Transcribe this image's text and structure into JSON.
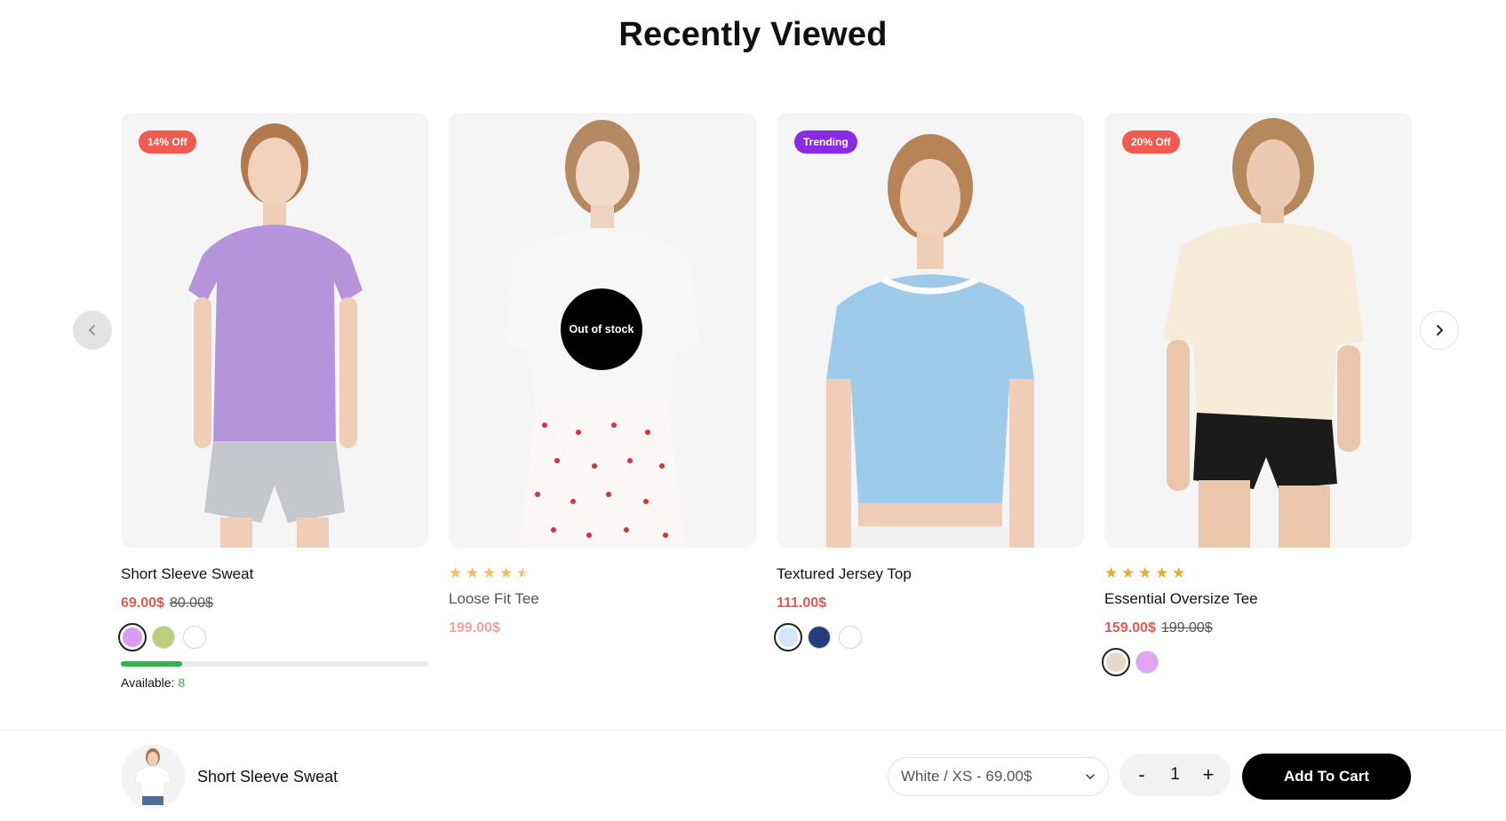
{
  "section": {
    "title": "Recently Viewed"
  },
  "colors": {
    "sale_red": "#e8584e",
    "sale_red_light": "#f4a19b",
    "badge_red": "#f05a50",
    "badge_purple": "#8a2be2",
    "star_gold": "#f3a623",
    "progress_green": "#2fb34a",
    "available_green": "#2fb34a"
  },
  "nav": {
    "prev_icon": "chevron-left-icon",
    "next_icon": "chevron-right-icon"
  },
  "products": [
    {
      "name": "Short Sleeve Sweat",
      "badge": "14% Off",
      "badge_color": "#f05a50",
      "price": "69.00$",
      "compare_price": "80.00$",
      "swatches": [
        "#d99bf4",
        "#bcd07a",
        "#ffffff"
      ],
      "active_swatch": 0,
      "availability_label": "Available:",
      "availability_count": "8",
      "stock_fraction": 0.2
    },
    {
      "name": "Loose Fit Tee",
      "rating": 4.5,
      "price": "199.00$",
      "stock_label": "Out of stock"
    },
    {
      "name": "Textured Jersey Top",
      "badge": "Trending",
      "badge_color": "#8a2be2",
      "price": "111.00$",
      "swatches": [
        "#d4e6fb",
        "#253d7a",
        "#ffffff"
      ],
      "active_swatch": 0
    },
    {
      "name": "Essential Oversize Tee",
      "badge": "20% Off",
      "badge_color": "#f05a50",
      "rating": 5,
      "price": "159.00$",
      "compare_price": "199.00$",
      "swatches": [
        "#e7dac6",
        "#e3a4f6"
      ],
      "active_swatch": 0
    }
  ],
  "sticky_cart": {
    "product_name": "Short Sleeve Sweat",
    "variant": "White / XS - 69.00$",
    "quantity": "1",
    "minus_label": "-",
    "plus_label": "+",
    "add_label": "Add To Cart"
  }
}
